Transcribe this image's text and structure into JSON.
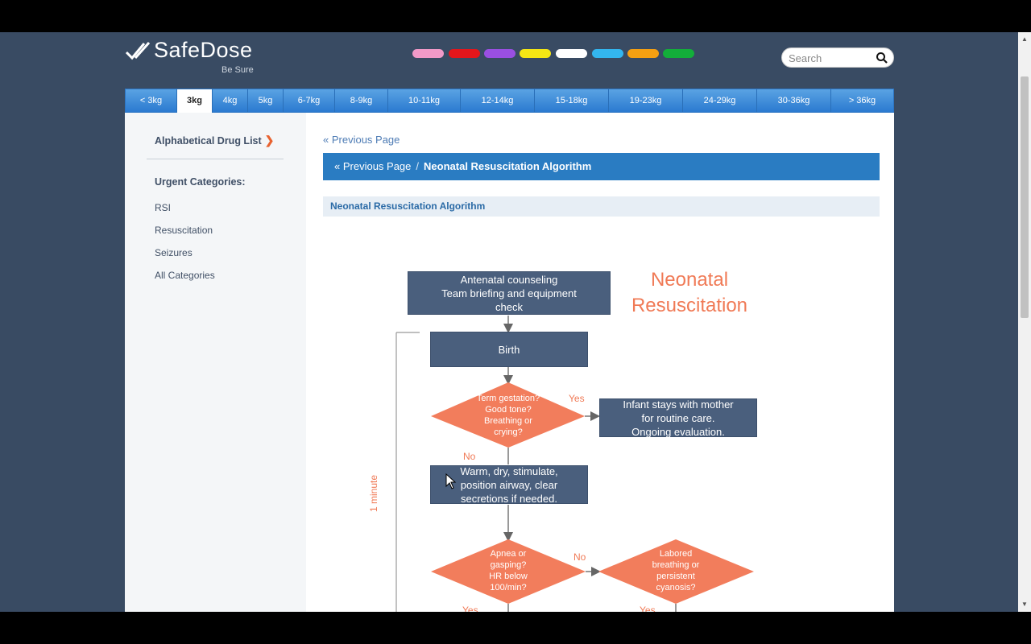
{
  "logo": {
    "name": "SafeDose",
    "tagline": "Be Sure"
  },
  "color_tabs": [
    "#f29ac8",
    "#e4161b",
    "#9a4fe2",
    "#f5e614",
    "#ffffff",
    "#33b6ef",
    "#f5a012",
    "#13ae3a"
  ],
  "search": {
    "placeholder": "Search"
  },
  "weight_tabs": [
    {
      "label": "< 3kg"
    },
    {
      "label": "3kg"
    },
    {
      "label": "4kg"
    },
    {
      "label": "5kg"
    },
    {
      "label": "6-7kg"
    },
    {
      "label": "8-9kg"
    },
    {
      "label": "10-11kg"
    },
    {
      "label": "12-14kg"
    },
    {
      "label": "15-18kg"
    },
    {
      "label": "19-23kg"
    },
    {
      "label": "24-29kg"
    },
    {
      "label": "30-36kg"
    },
    {
      "label": "> 36kg"
    }
  ],
  "weight_active": "3kg",
  "sidebar": {
    "alpha_list": "Alphabetical Drug List",
    "urgent_heading": "Urgent Categories:",
    "items": [
      {
        "label": "RSI"
      },
      {
        "label": "Resuscitation"
      },
      {
        "label": "Seizures"
      },
      {
        "label": "All Categories"
      }
    ]
  },
  "content": {
    "prev_link": "« Previous Page",
    "breadcrumb": {
      "prev": "« Previous Page",
      "separator": "/",
      "current": "Neonatal Resuscitation Algorithm"
    },
    "section_title": "Neonatal Resuscitation Algorithm"
  },
  "flowchart": {
    "title": "Neonatal\nResuscitation",
    "box_counseling": "Antenatal counseling\nTeam briefing and equipment\ncheck",
    "box_birth": "Birth",
    "diamond_term": "Term gestation?\nGood tone?\nBreathing or\ncrying?",
    "label_yes_1": "Yes",
    "box_mother": "Infant stays with mother\nfor routine care.\nOngoing evaluation.",
    "label_no_1": "No",
    "box_warm": "Warm, dry, stimulate,\nposition airway, clear\nsecretions if needed.",
    "minute_label": "1 minute",
    "diamond_apnea": "Apnea or\ngasping?\nHR below\n100/min?",
    "label_no_2": "No",
    "diamond_labored": "Labored\nbreathing or\npersistent\ncyanosis?",
    "label_yes_2": "Yes",
    "label_yes_3": "Yes"
  }
}
